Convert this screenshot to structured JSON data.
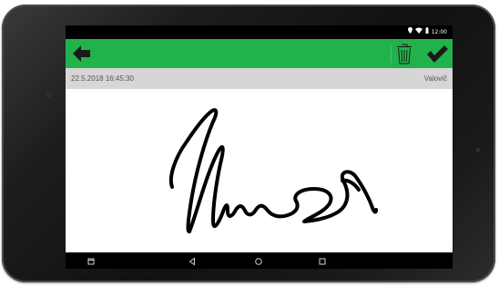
{
  "status_bar": {
    "time": "12:00",
    "icons": [
      "location-icon",
      "wifi-icon",
      "battery-icon"
    ]
  },
  "app_bar": {
    "background": "#22b24c",
    "back_icon": "arrow-left-icon",
    "trash_icon": "trash-icon",
    "confirm_icon": "check-icon"
  },
  "info_bar": {
    "date": "22.5.2018 16:45:30",
    "name": "Valovič"
  },
  "nav_bar": {
    "icons": [
      "recent-apps-icon",
      "back-triangle-icon",
      "home-circle-icon",
      "overview-square-icon"
    ]
  }
}
